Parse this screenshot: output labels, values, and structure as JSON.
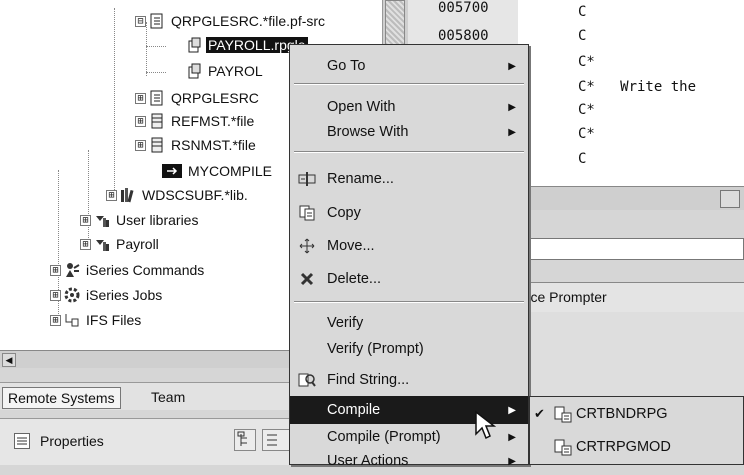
{
  "tree": {
    "items": [
      {
        "label": "QRPGLESRC.*file.pf-src",
        "expander": "⊟",
        "icon": "source-file-icon",
        "selected": false
      },
      {
        "label": "PAYROLL",
        "suffix": ".rpgle",
        "expander": "",
        "icon": "member-icon",
        "selected": true
      },
      {
        "label": "PAYROL",
        "expander": "",
        "icon": "member-icon",
        "selected": false
      },
      {
        "label": "QRPGLESRC",
        "expander": "⊞",
        "icon": "source-file-icon",
        "selected": false
      },
      {
        "label": "REFMST.*file",
        "expander": "⊞",
        "icon": "data-file-icon",
        "selected": false
      },
      {
        "label": "RSNMST.*file",
        "expander": "⊞",
        "icon": "data-file-icon",
        "selected": false
      },
      {
        "label": "MYCOMPILE",
        "expander": "",
        "icon": "program-icon",
        "selected": false
      },
      {
        "label": "WDSCSUBF.*lib.",
        "expander": "⊞",
        "icon": "library-icon",
        "selected": false
      },
      {
        "label": "User libraries",
        "expander": "⊞",
        "icon": "library-filter-icon",
        "selected": false
      },
      {
        "label": "Payroll",
        "expander": "⊞",
        "icon": "library-filter-icon",
        "selected": false
      },
      {
        "label": "iSeries Commands",
        "expander": "⊞",
        "icon": "commands-icon",
        "selected": false
      },
      {
        "label": "iSeries Jobs",
        "expander": "⊞",
        "icon": "jobs-icon",
        "selected": false
      },
      {
        "label": "IFS Files",
        "expander": "⊞",
        "icon": "ifs-icon",
        "selected": false
      }
    ]
  },
  "tabs": {
    "remote_systems": "Remote Systems",
    "team": "Team",
    "properties": "Properties"
  },
  "editor": {
    "lines": [
      {
        "seq": "005700",
        "code": "C"
      },
      {
        "seq": "005800",
        "code": "C"
      },
      {
        "seq": "",
        "code": "C*"
      },
      {
        "seq": "",
        "code": "C*   Write the"
      },
      {
        "seq": "",
        "code": "C*"
      },
      {
        "seq": "",
        "code": "C*"
      },
      {
        "seq": "",
        "code": "C"
      }
    ],
    "prompter_tab": "urce Prompter"
  },
  "context_menu": {
    "items": [
      {
        "label": "Go To",
        "submenu": true,
        "icon": ""
      },
      {
        "label": "Open With",
        "submenu": true,
        "icon": ""
      },
      {
        "label": "Browse With",
        "submenu": true,
        "icon": ""
      },
      {
        "label": "Rename...",
        "submenu": false,
        "icon": "rename-icon"
      },
      {
        "label": "Copy",
        "submenu": false,
        "icon": "copy-icon"
      },
      {
        "label": "Move...",
        "submenu": false,
        "icon": "move-icon"
      },
      {
        "label": "Delete...",
        "submenu": false,
        "icon": "delete-icon"
      },
      {
        "label": "Verify",
        "submenu": false,
        "icon": ""
      },
      {
        "label": "Verify (Prompt)",
        "submenu": false,
        "icon": ""
      },
      {
        "label": "Find String...",
        "submenu": false,
        "icon": "find-string-icon"
      },
      {
        "label": "Compile",
        "submenu": true,
        "icon": "",
        "active": true
      },
      {
        "label": "Compile (Prompt)",
        "submenu": true,
        "icon": ""
      },
      {
        "label": "User Actions",
        "submenu": true,
        "icon": ""
      }
    ]
  },
  "compile_submenu": {
    "items": [
      {
        "label": "CRTBNDRPG",
        "checked": true,
        "icon": "command-icon"
      },
      {
        "label": "CRTRPGMOD",
        "checked": false,
        "icon": "command-icon"
      }
    ]
  },
  "colors": {
    "selection": "#1a1a1a",
    "menu_bg": "#d9d9d9",
    "panel_bg": "#ffffff"
  }
}
